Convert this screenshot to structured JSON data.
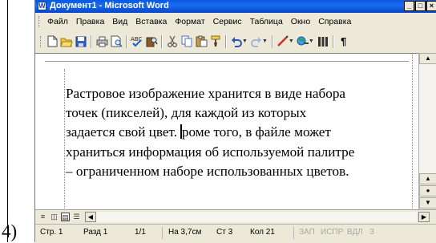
{
  "question_number": "4)",
  "window": {
    "title": "Документ1 - Microsoft Word",
    "icon_letter": "W",
    "buttons": {
      "minimize": "_",
      "maximize": "□",
      "close": "×"
    }
  },
  "menu": [
    {
      "label": "Файл"
    },
    {
      "label": "Правка"
    },
    {
      "label": "Вид"
    },
    {
      "label": "Вставка"
    },
    {
      "label": "Формат"
    },
    {
      "label": "Сервис"
    },
    {
      "label": "Таблица"
    },
    {
      "label": "Окно"
    },
    {
      "label": "Справка"
    }
  ],
  "toolbar": {
    "icons": [
      "new-document",
      "open-folder",
      "save",
      "print",
      "print-preview",
      "spelling",
      "research",
      "cut",
      "copy",
      "paste",
      "format-painter",
      "undo",
      "redo",
      "drawing",
      "hyperlink",
      "columns",
      "show-formatting"
    ]
  },
  "document": {
    "lines": [
      "Растровое изображение хранится в виде набора",
      "точек (пикселей), для каждой из которых",
      "задается свой цвет. ",
      "роме того, в файле может",
      "храниться информация об используемой палитре",
      "– ограниченном наборе использованных цветов."
    ]
  },
  "statusbar": {
    "page": "Стр. 1",
    "section": "Разд 1",
    "pages": "1/1",
    "at": "На 3,7см",
    "line": "Ст 3",
    "col": "Кол 21",
    "rec": "ЗАП",
    "trk": "ИСПР",
    "ext": "ВДЛ",
    "ovr": "З"
  },
  "colors": {
    "titlebar": "#0a58e0",
    "chrome": "#ece9d8"
  }
}
